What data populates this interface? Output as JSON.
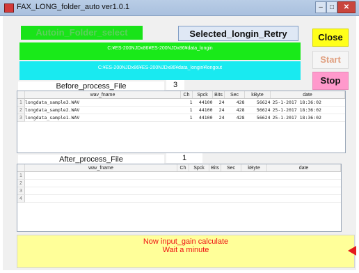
{
  "window": {
    "title": "FAX_LONG_folder_auto  ver1.0.1"
  },
  "buttons": {
    "autoin": "Autoin_Folder_select",
    "retry": "Selected_longin_Retry",
    "close": "Close",
    "start": "Start",
    "stop": "Stop"
  },
  "paths": {
    "input": "C:¥ES-200NJDx86¥ES-200NJDx86¥data_longin",
    "output": "C:¥ES-200NJDx86¥ES-200NJDx86¥data_longin¥longout"
  },
  "before": {
    "label": "Before_process_File",
    "count": "3",
    "columns": [
      "wav_fname",
      "Ch",
      "Spck",
      "Bits",
      "Sec",
      "kByte",
      "date"
    ],
    "rows": [
      {
        "n": "1",
        "fname": "longdata_sample3.WAV",
        "ch": "1",
        "spck": "44100",
        "bits": "24",
        "sec": "428",
        "kbyte": "56624",
        "date": "25-1-2017 18:36:02"
      },
      {
        "n": "2",
        "fname": "longdata_sample2.WAV",
        "ch": "1",
        "spck": "44100",
        "bits": "24",
        "sec": "428",
        "kbyte": "56624",
        "date": "25-1-2017 18:36:02"
      },
      {
        "n": "3",
        "fname": "longdata_sample1.WAV",
        "ch": "1",
        "spck": "44100",
        "bits": "24",
        "sec": "428",
        "kbyte": "56624",
        "date": "25-1-2017 18:36:02"
      }
    ]
  },
  "after": {
    "label": "After_process_File",
    "count": "1",
    "columns": [
      "wav_fname",
      "Ch",
      "Spck",
      "Bits",
      "Sec",
      "kByte",
      "date"
    ],
    "row_numbers": [
      "1",
      "2",
      "3",
      "4"
    ]
  },
  "status": {
    "line1": "Now input_gain calculate",
    "line2": "Wait a minute"
  },
  "colors": {
    "input_path_bg": "#19ea19",
    "output_path_bg": "#19eaf0",
    "close_bg": "#ffff1a",
    "stop_bg": "#ff99cc",
    "status_bg": "#ffff99",
    "status_text": "#ee1111"
  }
}
